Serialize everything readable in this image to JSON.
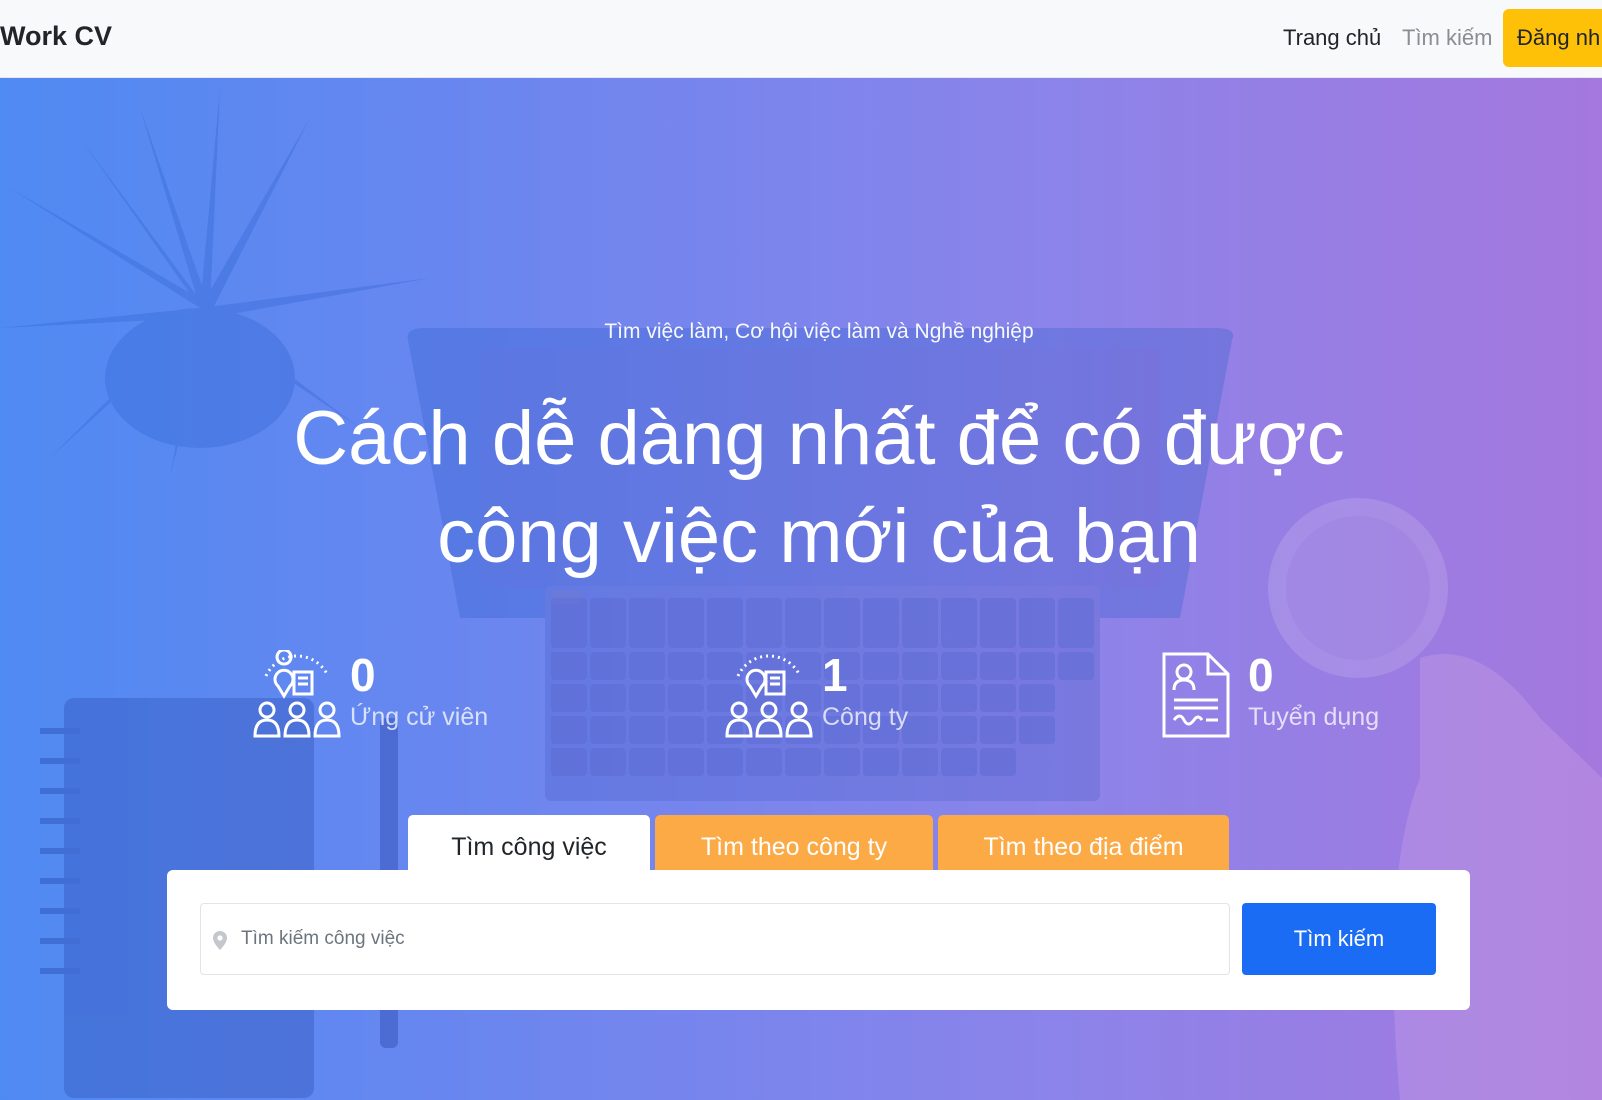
{
  "navbar": {
    "brand": "Work CV",
    "links": [
      {
        "label": "Trang chủ"
      },
      {
        "label": "Tìm kiếm"
      }
    ],
    "login_label": "Đăng nh"
  },
  "hero": {
    "subtitle": "Tìm việc làm, Cơ hội việc làm và Nghề nghiệp",
    "title_line1": "Cách dễ dàng nhất để có được",
    "title_line2": "công việc mới của bạn"
  },
  "stats": [
    {
      "value": "0",
      "label": "Ứng cử viên",
      "icon": "candidates-icon"
    },
    {
      "value": "1",
      "label": "Công ty",
      "icon": "company-icon"
    },
    {
      "value": "0",
      "label": "Tuyển dụng",
      "icon": "recruitment-document-icon"
    }
  ],
  "tabs": [
    {
      "label": "Tìm công việc",
      "active": true
    },
    {
      "label": "Tìm theo công ty",
      "active": false
    },
    {
      "label": "Tìm theo địa điểm",
      "active": false
    }
  ],
  "search": {
    "placeholder": "Tìm kiếm công việc",
    "value": "",
    "button_label": "Tìm kiếm"
  },
  "colors": {
    "login_button": "#ffc107",
    "tab_inactive": "#fbaa45",
    "search_button": "#1a6cf4",
    "gradient_start": "#4f8af2",
    "gradient_end": "#a478dd"
  }
}
